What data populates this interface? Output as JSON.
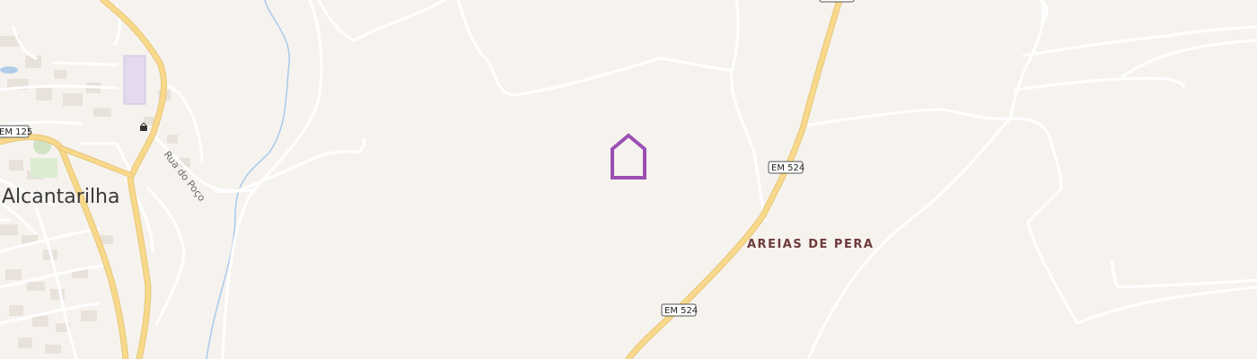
{
  "map": {
    "town_label": "Alcantarilha",
    "locality_label": "AREIAS DE PERA",
    "street_label": "Rua do Poço",
    "shields": [
      "EM 125",
      "EM 524",
      "EM 524"
    ],
    "marker_icon": "home-outline-icon",
    "colors": {
      "background": "#f6f3ef",
      "major_road": "#f7d27a",
      "minor_road": "#ffffff",
      "river": "#9cc2e6",
      "marker": "#9b4fb3",
      "locality_text": "#6e3a3a"
    }
  }
}
